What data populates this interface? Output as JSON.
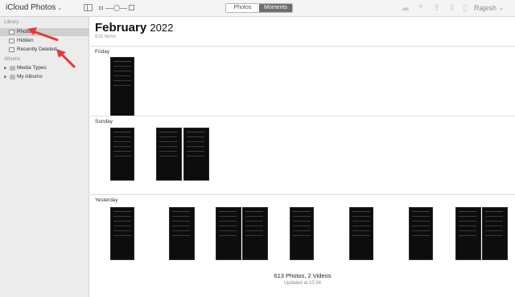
{
  "header": {
    "app_title": "iCloud Photos",
    "segments": [
      "Photos",
      "Moments"
    ],
    "active_segment": "Moments",
    "user_name": "Rajesh",
    "toolbar_icons": [
      "upload-icon",
      "add-icon",
      "share-icon",
      "download-icon",
      "delete-icon"
    ]
  },
  "sidebar": {
    "library_heading": "Library",
    "library_items": [
      {
        "label": "Photos",
        "icon": "photos-icon",
        "selected": true
      },
      {
        "label": "Hidden",
        "icon": "hidden-icon",
        "selected": false
      },
      {
        "label": "Recently Deleted",
        "icon": "trash-icon",
        "selected": false
      }
    ],
    "albums_heading": "Albums",
    "album_items": [
      {
        "label": "Media Types"
      },
      {
        "label": "My Albums"
      }
    ]
  },
  "main": {
    "month": "February",
    "year": "2022",
    "item_count": "615 Items",
    "sections": [
      {
        "day": "Friday",
        "photo_count": 1
      },
      {
        "day": "Sunday",
        "photo_count": 3
      },
      {
        "day": "Yesterday",
        "photo_count": 11
      }
    ],
    "summary": "613 Photos, 2 Videos",
    "updated": "Updated at 10:34"
  },
  "colors": {
    "annotation_arrow": "#e53935",
    "sidebar_bg": "#ececec",
    "selected_segment": "#6e6e6e"
  }
}
